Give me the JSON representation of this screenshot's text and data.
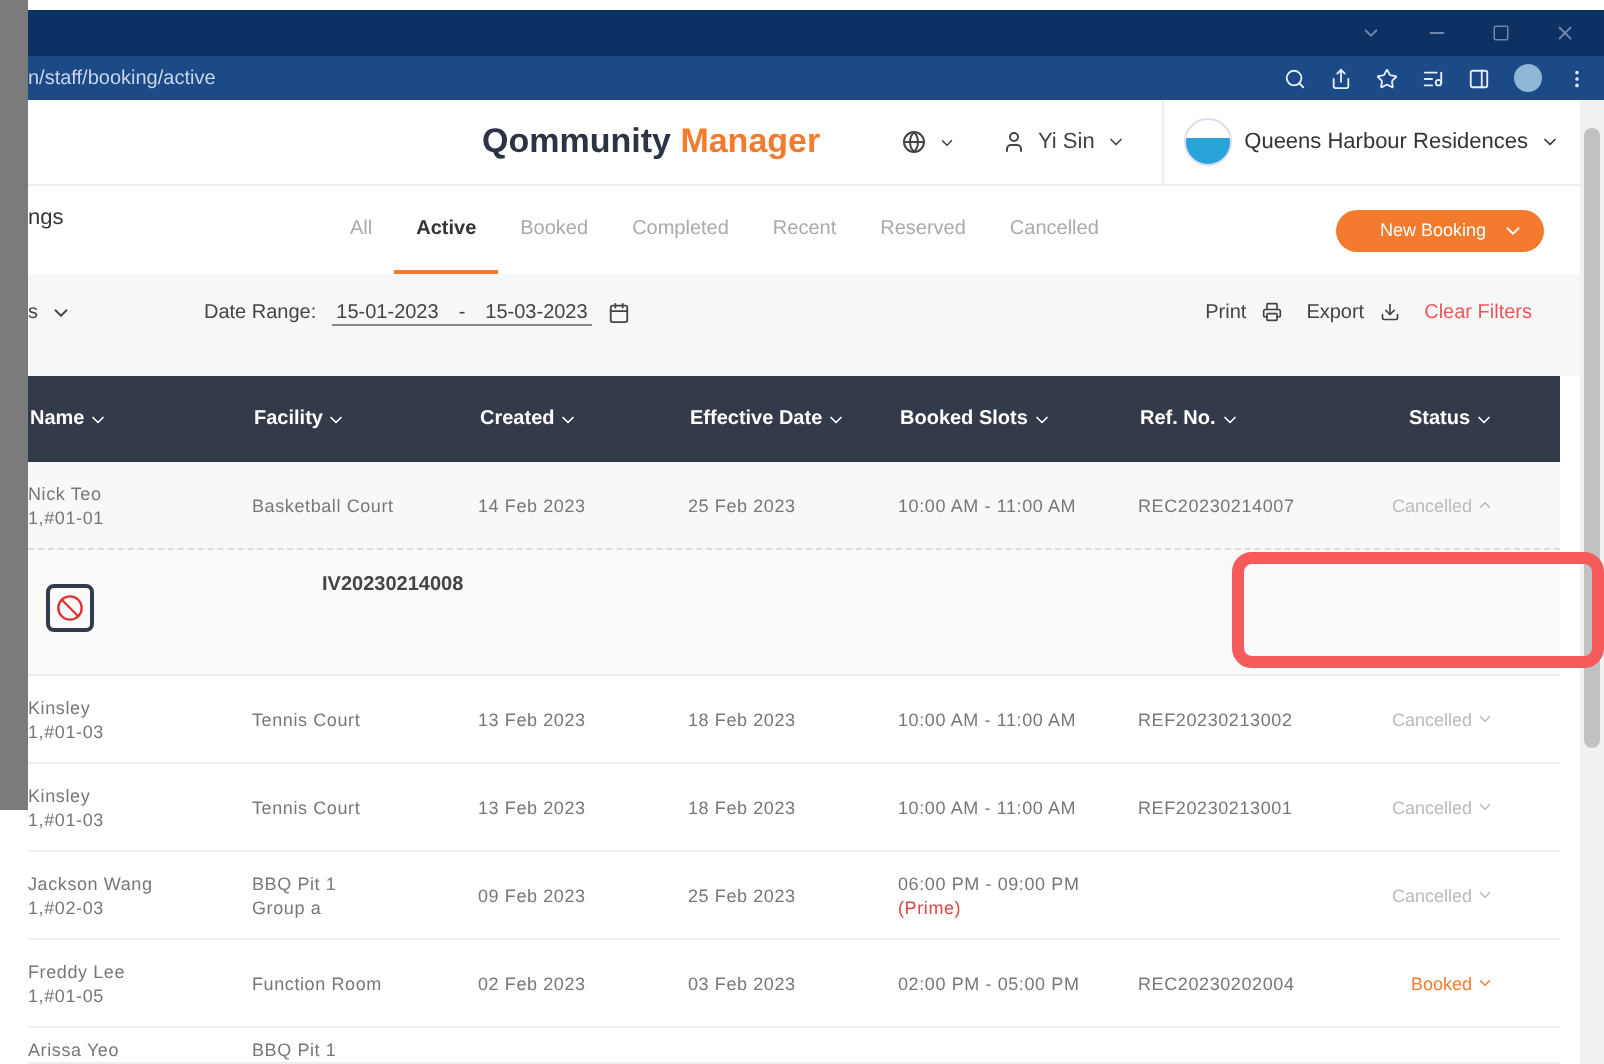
{
  "browser": {
    "url": "n/staff/booking/active"
  },
  "header": {
    "logo_primary": "Qommunity",
    "logo_accent": "Manager",
    "user": "Yi Sin",
    "property": "Queens Harbour Residences"
  },
  "page": {
    "title": "ngs"
  },
  "tabs": [
    {
      "label": "All",
      "selected": false
    },
    {
      "label": "Active",
      "selected": true
    },
    {
      "label": "Booked",
      "selected": false
    },
    {
      "label": "Completed",
      "selected": false
    },
    {
      "label": "Recent",
      "selected": false
    },
    {
      "label": "Reserved",
      "selected": false
    },
    {
      "label": "Cancelled",
      "selected": false
    }
  ],
  "new_booking": "New Booking",
  "filters": {
    "dropdown": "s",
    "date_label": "Date Range:",
    "date_from": "15-01-2023",
    "date_sep": "-",
    "date_to": "15-03-2023",
    "print": "Print",
    "export": "Export",
    "clear": "Clear Filters"
  },
  "table": {
    "columns": [
      "Name",
      "Facility",
      "Created",
      "Effective Date",
      "Booked Slots",
      "Ref. No.",
      "Status"
    ],
    "rows": [
      {
        "name": "Nick Teo",
        "unit": "1,#01-01",
        "facility": "Basketball Court",
        "created": "14 Feb 2023",
        "effective": "25 Feb 2023",
        "slots": "10:00 AM - 11:00 AM",
        "ref": "REC20230214007",
        "status": "Cancelled",
        "color": "#bbbbbb",
        "expanded": true,
        "detail_ref": "IV20230214008"
      },
      {
        "name": "Kinsley",
        "unit": "1,#01-03",
        "facility": "Tennis Court",
        "created": "13 Feb 2023",
        "effective": "18 Feb 2023",
        "slots": "10:00 AM - 11:00 AM",
        "ref": "REF20230213002",
        "status": "Cancelled",
        "color": "#bbbbbb",
        "expanded": false
      },
      {
        "name": "Kinsley",
        "unit": "1,#01-03",
        "facility": "Tennis Court",
        "created": "13 Feb 2023",
        "effective": "18 Feb 2023",
        "slots": "10:00 AM - 11:00 AM",
        "ref": "REF20230213001",
        "status": "Cancelled",
        "color": "#bbbbbb",
        "expanded": false
      },
      {
        "name": "Jackson Wang",
        "unit": "1,#02-03",
        "facility": "BBQ Pit 1",
        "group": "Group a",
        "created": "09 Feb 2023",
        "effective": "25 Feb 2023",
        "slots": "06:00 PM - 09:00 PM",
        "prime": "(Prime)",
        "status": "Cancelled",
        "color": "#bbbbbb",
        "expanded": false
      },
      {
        "name": "Freddy Lee",
        "unit": "1,#01-05",
        "facility": "Function Room",
        "created": "02 Feb 2023",
        "effective": "03 Feb 2023",
        "slots": "02:00 PM - 05:00 PM",
        "ref": "REC20230202004",
        "status": "Booked",
        "color": "#f47b2e",
        "expanded": false
      },
      {
        "name": "Arissa Yeo",
        "facility": "BBQ Pit 1"
      }
    ]
  }
}
